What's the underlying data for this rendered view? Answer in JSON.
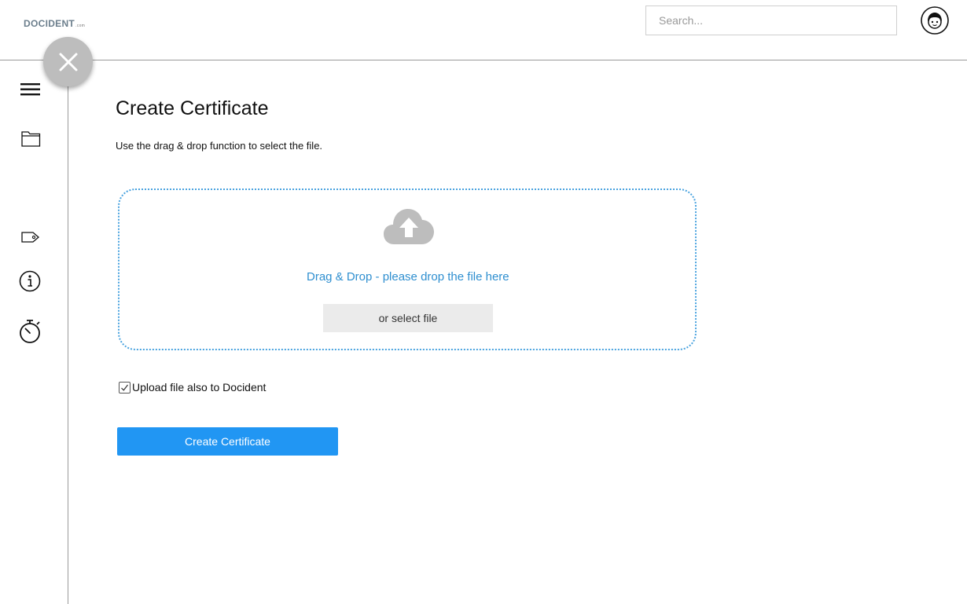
{
  "header": {
    "logo_main": "DOCIDENT",
    "logo_tld": ".com",
    "search_placeholder": "Search...",
    "search_value": ""
  },
  "icons": {
    "close": "close-icon",
    "menu": "hamburger-menu-icon",
    "folder": "folder-icon",
    "tag": "tag-icon",
    "info": "info-icon",
    "timer": "stopwatch-icon",
    "upload": "cloud-upload-icon",
    "avatar": "user-avatar-icon"
  },
  "main": {
    "title": "Create Certificate",
    "instructions": "Use the drag & drop function to select the file.",
    "dropzone": {
      "text": "Drag & Drop - please drop the file here",
      "select_label": "or select file"
    },
    "upload_option": {
      "label": "Upload file also to Docident",
      "checked": true
    },
    "submit_label": "Create Certificate"
  },
  "colors": {
    "primary": "#2196f3",
    "dropzone_border": "#4aa3df",
    "drop_text": "#2f8fd0",
    "fab": "#bdbdbd",
    "logo_accent": "#2f6fa3"
  }
}
